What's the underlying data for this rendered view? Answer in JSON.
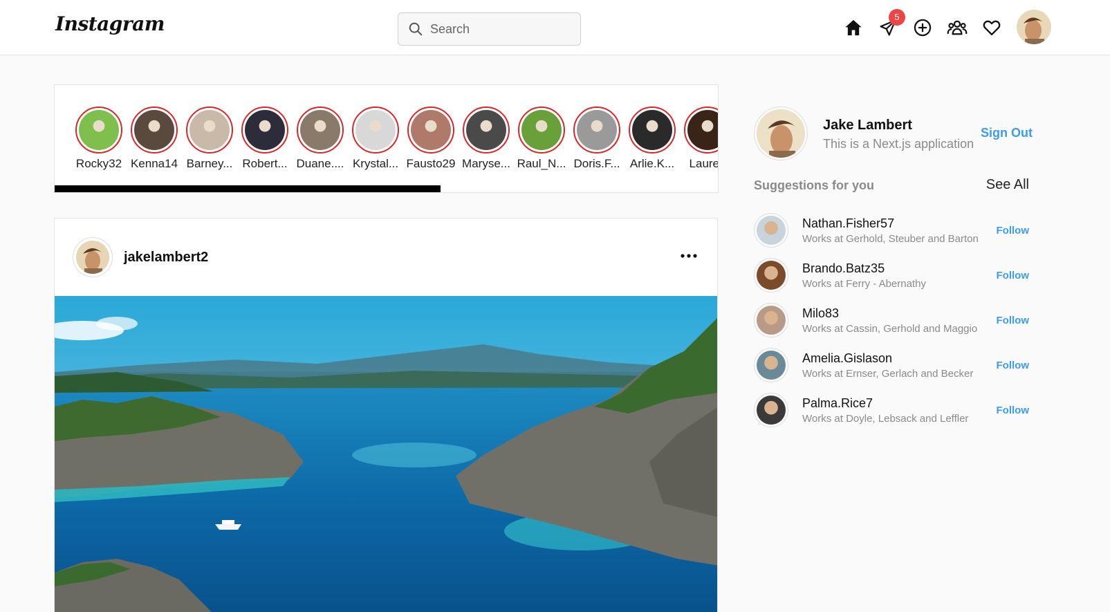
{
  "header": {
    "logo": "Instagram",
    "search_placeholder": "Search",
    "messages_badge": "5"
  },
  "stories": [
    {
      "name": "Rocky32",
      "bg": "#7fbf4d"
    },
    {
      "name": "Kenna14",
      "bg": "#5a4a3e"
    },
    {
      "name": "Barney...",
      "bg": "#c9b9a8"
    },
    {
      "name": "Robert...",
      "bg": "#2c2c3a"
    },
    {
      "name": "Duane....",
      "bg": "#8a7a6a"
    },
    {
      "name": "Krystal...",
      "bg": "#d8d8d8"
    },
    {
      "name": "Fausto29",
      "bg": "#b07a6a"
    },
    {
      "name": "Maryse...",
      "bg": "#4a4a4a"
    },
    {
      "name": "Raul_N...",
      "bg": "#6aa03a"
    },
    {
      "name": "Doris.F...",
      "bg": "#9a9a9a"
    },
    {
      "name": "Arlie.K...",
      "bg": "#2a2a2a"
    },
    {
      "name": "Lauren",
      "bg": "#3a2418"
    }
  ],
  "post": {
    "username": "jakelambert2"
  },
  "profile": {
    "name": "Jake Lambert",
    "subtitle": "This is a Next.js application",
    "signout_label": "Sign Out"
  },
  "suggestions": {
    "title": "Suggestions for you",
    "see_all_label": "See All",
    "follow_label": "Follow",
    "items": [
      {
        "name": "Nathan.Fisher57",
        "sub": "Works at Gerhold, Steuber and Barton",
        "bg": "#c8d4dc"
      },
      {
        "name": "Brando.Batz35",
        "sub": "Works at Ferry - Abernathy",
        "bg": "#7a4a2a"
      },
      {
        "name": "Milo83",
        "sub": "Works at Cassin, Gerhold and Maggio",
        "bg": "#b89a86"
      },
      {
        "name": "Amelia.Gislason",
        "sub": "Works at Ernser, Gerlach and Becker",
        "bg": "#6a8a9a"
      },
      {
        "name": "Palma.Rice7",
        "sub": "Works at Doyle, Lebsack and Leffler",
        "bg": "#3a3a3a"
      }
    ]
  }
}
